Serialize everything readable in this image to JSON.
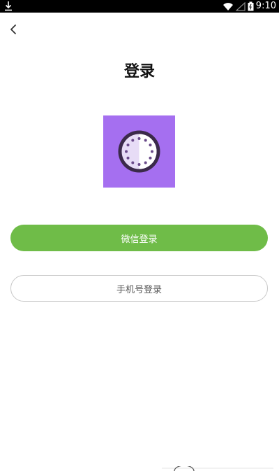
{
  "status_bar": {
    "time": "9:10",
    "icons": [
      "download-icon",
      "wifi-icon",
      "signal-icon",
      "battery-icon"
    ]
  },
  "header": {
    "back_icon": "chevron-left-icon",
    "title": "登录"
  },
  "logo": {
    "icon": "clock-dial-icon",
    "bg_color": "#a56ff0"
  },
  "buttons": {
    "wechat_login": "微信登录",
    "phone_login": "手机号登录"
  },
  "colors": {
    "accent_green": "#6fbc48",
    "logo_purple": "#a56ff0"
  }
}
